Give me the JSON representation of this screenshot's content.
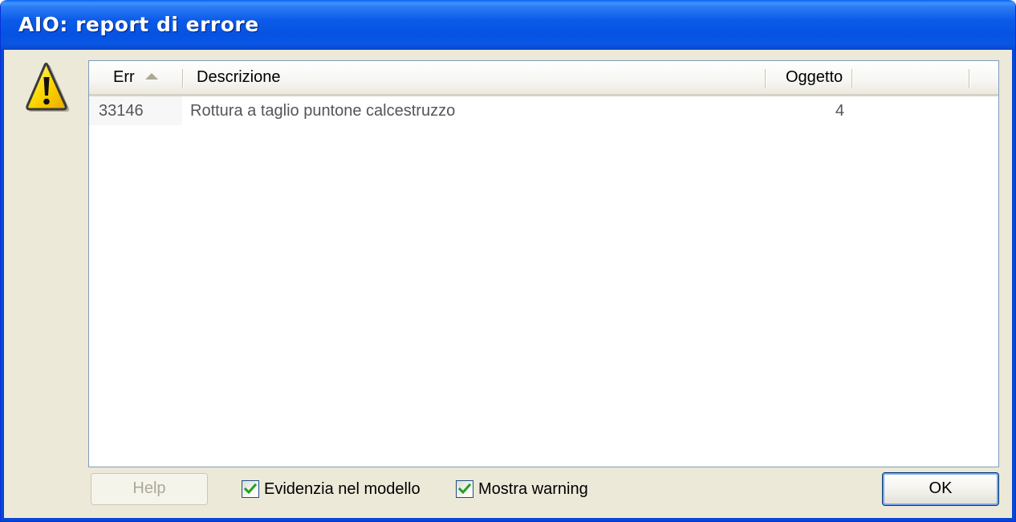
{
  "window": {
    "title": "AIO: report di errore"
  },
  "icons": {
    "warning": "warning-triangle-icon",
    "sort": "sort-ascending-icon",
    "check": "checkmark-icon"
  },
  "list": {
    "columns": {
      "err": "Err",
      "descrizione": "Descrizione",
      "oggetto": "Oggetto"
    },
    "sort_column": "Err",
    "rows": [
      {
        "err": "33146",
        "descrizione": "Rottura a taglio puntone calcestruzzo",
        "oggetto": "4"
      }
    ]
  },
  "footer": {
    "help_label": "Help",
    "help_enabled": false,
    "checkbox_evidenzia": {
      "label": "Evidenzia nel modello",
      "checked": true
    },
    "checkbox_mostra": {
      "label": "Mostra warning",
      "checked": true
    },
    "ok_label": "OK"
  },
  "colors": {
    "titlebar": "#0a56e5",
    "dialog_bg": "#ece9d8",
    "checkbox_tick": "#21a121",
    "warning_yellow": "#ffd800"
  }
}
